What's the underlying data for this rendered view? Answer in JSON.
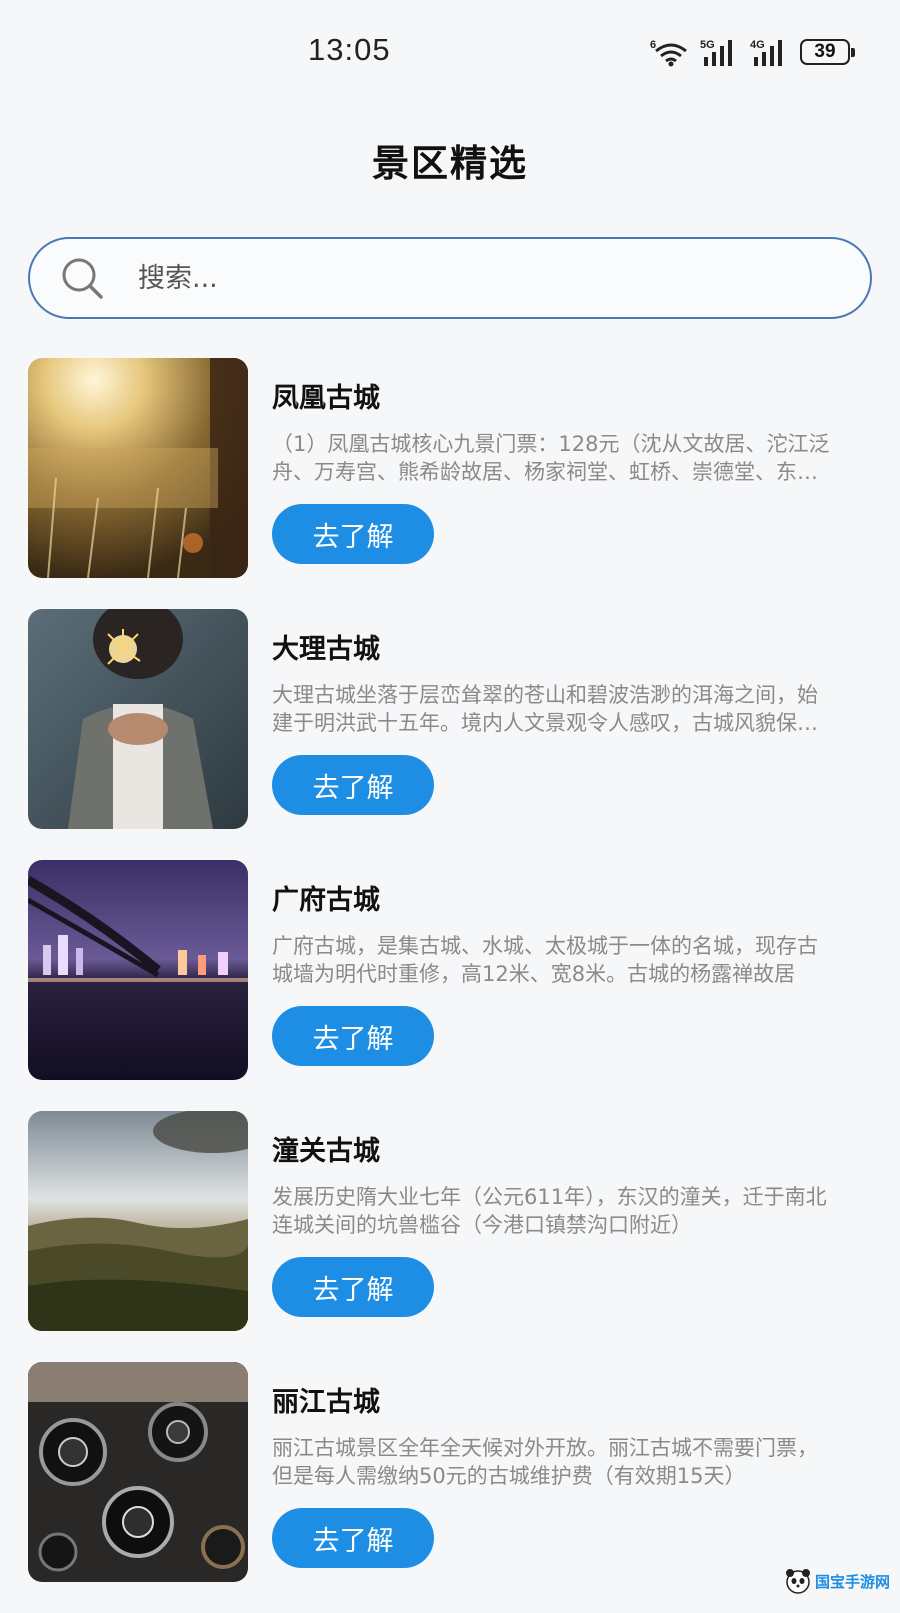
{
  "status_bar": {
    "time": "13:05",
    "wifi_label": "6",
    "signal_1_label": "5G",
    "signal_2_label": "4G",
    "battery": "39",
    "icons": [
      "wifi-icon",
      "signal-5g-icon",
      "signal-4g-icon",
      "battery-icon"
    ]
  },
  "header": {
    "title": "景区精选"
  },
  "search": {
    "placeholder": "搜索...",
    "value": "",
    "icon": "search-icon"
  },
  "scenic_list": {
    "items": [
      {
        "title": "凤凰古城",
        "description": "（1）凤凰古城核心九景门票：128元（沈从文故居、沱江泛舟、万寿宫、熊希龄故居、杨家祠堂、虹桥、崇德堂、东门城楼、古城博物馆）",
        "button": "去了解"
      },
      {
        "title": "大理古城",
        "description": "大理古城坐落于层峦耸翠的苍山和碧波浩渺的洱海之间，始建于明洪武十五年。境内人文景观令人感叹，古城风貌保存完好",
        "button": "去了解"
      },
      {
        "title": "广府古城",
        "description": "广府古城，是集古城、水城、太极城于一体的名城，现存古城墙为明代时重修，高12米、宽8米。古城的杨露禅故居",
        "button": "去了解"
      },
      {
        "title": "潼关古城",
        "description": "发展历史隋大业七年（公元611年），东汉的潼关，迁于南北连城关间的坑兽槛谷（今港口镇禁沟口附近）",
        "button": "去了解"
      },
      {
        "title": "丽江古城",
        "description": "丽江古城景区全年全天候对外开放。丽江古城不需要门票，但是每人需缴纳50元的古城维护费（有效期15天）",
        "button": "去了解"
      }
    ]
  },
  "watermark": {
    "text": "国宝手游网"
  },
  "colors": {
    "accent": "#1e8ee5",
    "search_border": "#4a78b5",
    "background": "#f6f7f9",
    "description_text": "#8a8a8a"
  }
}
